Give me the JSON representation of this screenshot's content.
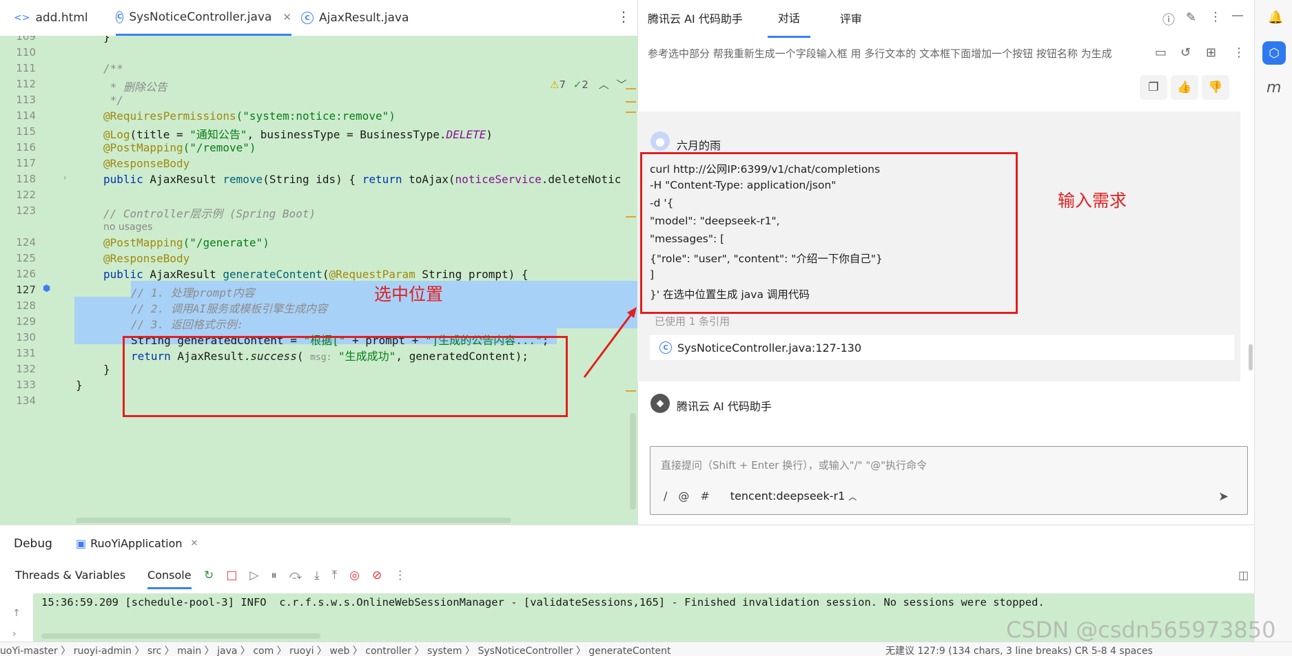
{
  "editor_tabs": [
    {
      "label": "add.html"
    },
    {
      "label": "SysNoticeController.java"
    },
    {
      "label": "AjaxResult.java"
    }
  ],
  "inspections": {
    "warnings": "7",
    "checks": "2"
  },
  "line_numbers": [
    "109",
    "110",
    "111",
    "112",
    "113",
    "114",
    "115",
    "116",
    "117",
    "118",
    "122",
    "123",
    "124",
    "125",
    "126",
    "127",
    "128",
    "129",
    "130",
    "131",
    "132",
    "133",
    "134"
  ],
  "code": {
    "l109": "}",
    "l111": "/**",
    "l112": " * 删除公告",
    "l113": " */",
    "l114_ann": "@RequiresPermissions",
    "l114_str": "(\"system:notice:remove\")",
    "l115_ann": "@Log",
    "l115_a": "(title = ",
    "l115_str": "\"通知公告\"",
    "l115_b": ", businessType = BusinessType.",
    "l115_it": "DELETE",
    "l115_c": ")",
    "l116_ann": "@PostMapping",
    "l116_str": "(\"/remove\")",
    "l117_ann": "@ResponseBody",
    "l118_kw": "public",
    "l118_a": " AjaxResult ",
    "l118_fn": "remove",
    "l118_b": "(String ids) { ",
    "l118_kw2": "return",
    "l118_c": " toAjax(",
    "l118_fld": "noticeService",
    "l118_d": ".deleteNotic",
    "l123": "// Controller层示例 (Spring Boot)",
    "usages": "no usages",
    "l124_ann": "@PostMapping",
    "l124_str": "(\"/generate\")",
    "l125_ann": "@ResponseBody",
    "l126_kw": "public",
    "l126_a": " AjaxResult ",
    "l126_fn": "generateContent",
    "l126_b": "(",
    "l126_ann": "@RequestParam",
    "l126_c": " String prompt) {",
    "l127": "// 1. 处理prompt内容",
    "l128": "// 2. 调用AI服务或模板引擎生成内容",
    "l129": "// 3. 返回格式示例:",
    "l130_a": "String generatedContent = ",
    "l130_s1": "\"根据[\"",
    "l130_b": " + prompt + ",
    "l130_s2": "\"]生成的公告内容...\"",
    "l130_c": ";",
    "l131_kw": "return",
    "l131_a": " AjaxResult.",
    "l131_it": "success",
    "l131_b": "( ",
    "l131_hint": "msg:",
    "l131_str": " \"生成成功\"",
    "l131_c": ", generatedContent);",
    "l132": "}",
    "l133": "}"
  },
  "annotations": {
    "selection_label": "选中位置",
    "request_label": "输入需求"
  },
  "ai_panel": {
    "title": "腾讯云 AI 代码助手",
    "tabs": [
      "对话",
      "评审"
    ],
    "prompt": "参考选中部分 帮我重新生成一个字段输入框 用 多行文本的 文本框下面增加一个按钮 按钮名称 为生成",
    "user_name": "六月的雨",
    "request_lines": [
      "curl http://公网IP:6399/v1/chat/completions",
      "-H \"Content-Type: application/json\"",
      "-d '{",
      "\"model\": \"deepseek-r1\",",
      "\"messages\": [",
      "{\"role\": \"user\", \"content\": \"介绍一下你自己\"}",
      "]",
      "}' 在选中位置生成 java 调用代码"
    ],
    "ref_count": "已使用 1 条引用",
    "ref_file": "SysNoticeController.java:127-130",
    "bot_name": "腾讯云 AI 代码助手",
    "input_placeholder": "直接提问（Shift + Enter 换行），或输入\"/\" \"@\"执行命令",
    "input_tools": [
      "/",
      "@",
      "#"
    ],
    "model": "tencent:deepseek-r1"
  },
  "debug": {
    "title": "Debug",
    "run_config": "RuoYiApplication",
    "tabs": [
      "Threads & Variables",
      "Console"
    ],
    "console_line": "15:36:59.209 [schedule-pool-3] INFO  c.r.f.s.w.s.OnlineWebSessionManager - [validateSessions,165] - Finished invalidation session. No sessions were stopped."
  },
  "status": {
    "breadcrumb": "uoYi-master 〉 ruoyi-admin 〉 src 〉 main 〉 java 〉 com 〉 ruoyi 〉 web 〉 controller 〉 system 〉 SysNoticeController 〉 generateContent",
    "right": "无建议    127:9 (134 chars, 3 line breaks)    CR    5-8    4 spaces"
  },
  "watermark": "CSDN @csdn565973850",
  "colors": {
    "accent": "#3d7ff5",
    "editor_bg": "#cdeccd",
    "selection": "#a8d1f7",
    "annotation_red": "#e02020"
  }
}
